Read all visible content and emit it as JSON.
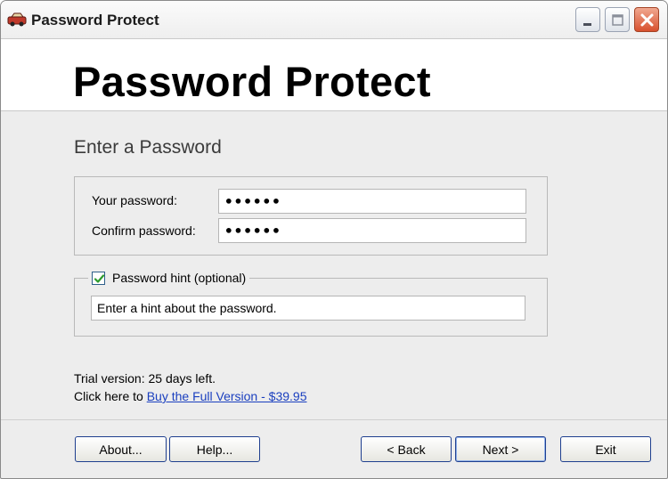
{
  "window": {
    "title": "Password Protect"
  },
  "banner": {
    "title": "Password Protect"
  },
  "form": {
    "section_title": "Enter a Password",
    "password_label": "Your password:",
    "password_value": "••••••",
    "confirm_label": "Confirm password:",
    "confirm_value": "••••••",
    "hint_checkbox_label": "Password hint (optional)",
    "hint_checked": true,
    "hint_value": "Enter a hint about the password."
  },
  "trial": {
    "days_text": "Trial version: 25 days left.",
    "buy_prefix": "Click here to ",
    "buy_link": "Buy the Full Version - $39.95"
  },
  "buttons": {
    "about": "About...",
    "help": "Help...",
    "back": "< Back",
    "next": "Next >",
    "exit": "Exit"
  },
  "icons": {
    "app": "car-icon",
    "minimize": "minimize-icon",
    "maximize": "maximize-icon",
    "close": "close-icon",
    "check": "checkmark-icon"
  },
  "colors": {
    "link": "#1a3fbf",
    "close_button": "#d8502e",
    "checkmark": "#2d9b2d"
  }
}
